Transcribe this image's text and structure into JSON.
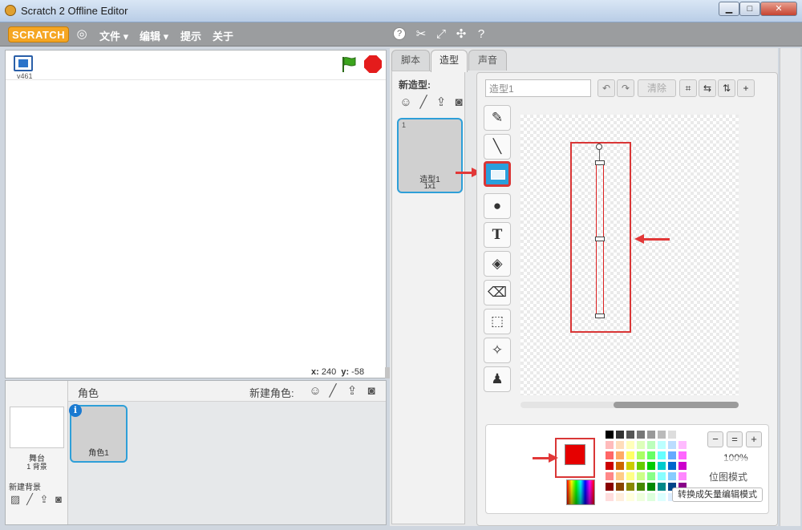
{
  "window": {
    "title": "Scratch 2 Offline Editor",
    "min": "▁",
    "max": "□",
    "close": "✕"
  },
  "menubar": {
    "logo": "SCRATCH",
    "globe_icon": "globe-icon",
    "items": [
      "文件 ▾",
      "编辑 ▾",
      "提示",
      "关于"
    ],
    "tools": [
      "stamp-icon",
      "cut-icon",
      "grow-icon",
      "shrink-icon",
      "help-icon"
    ]
  },
  "stage": {
    "version": "v461",
    "coords": {
      "x_label": "x:",
      "x": "240",
      "y_label": "y:",
      "y": "-58"
    }
  },
  "sprites": {
    "title": "角色",
    "new_sprite_label": "新建角色:",
    "stage_label": "舞台",
    "stage_bg_count": "1 背景",
    "new_bg_label": "新建背景",
    "sprite_name": "角色1",
    "info": "i"
  },
  "editor": {
    "tabs": [
      "脚本",
      "造型",
      "声音"
    ],
    "active_tab": "造型",
    "new_costume_label": "新造型:",
    "costume": {
      "number": "1",
      "name": "造型1",
      "size": "1x1"
    },
    "costume_name_value": "造型1",
    "buttons": {
      "undo": "↶",
      "redo": "↷",
      "clear": "清除",
      "crop": "⌗",
      "flip_h": "⇆",
      "flip_v": "⇅",
      "set_center": "+"
    },
    "help": "?",
    "tools": [
      "brush-icon",
      "line-icon",
      "rectangle-icon",
      "ellipse-icon",
      "text-icon",
      "fill-icon",
      "eraser-icon",
      "select-icon",
      "magic-wand-icon",
      "stamp-icon"
    ],
    "tool_glyphs": [
      "✎",
      "╲",
      "",
      "●",
      "T",
      "◈",
      "⌫",
      "⬚",
      "✧",
      "♟"
    ],
    "zoom": {
      "zoom_out": "−",
      "reset": "=",
      "zoom_in": "+",
      "level": "100%"
    },
    "mode_label": "位图模式",
    "convert_button": "转换成矢量编辑模式",
    "current_color": "#e60000",
    "accent": "#2e9fd8",
    "highlight": "#d93636"
  }
}
